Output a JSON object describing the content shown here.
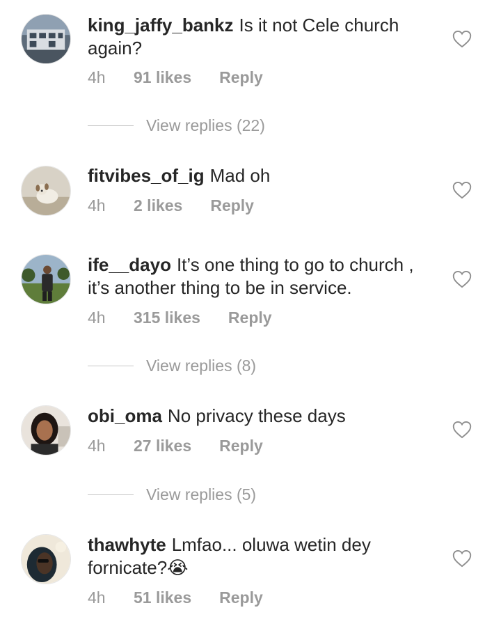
{
  "comments": [
    {
      "username": "king_jaffy_bankz",
      "text": "Is it not Cele church again?",
      "time": "4h",
      "likes": "91 likes",
      "reply": "Reply",
      "view_replies": "View replies (22)"
    },
    {
      "username": "fitvibes_of_ig",
      "text": "Mad oh",
      "time": "4h",
      "likes": "2 likes",
      "reply": "Reply"
    },
    {
      "username": "ife__dayo",
      "text": "It’s one thing to go to church , it’s another thing to be in service.",
      "time": "4h",
      "likes": "315 likes",
      "reply": "Reply",
      "view_replies": "View replies (8)"
    },
    {
      "username": "obi_oma",
      "text": "No privacy these days",
      "time": "4h",
      "likes": "27 likes",
      "reply": "Reply",
      "view_replies": "View replies (5)"
    },
    {
      "username": "thawhyte",
      "text": "Lmfao... oluwa wetin dey fornicate?😭",
      "time": "4h",
      "likes": "51 likes",
      "reply": "Reply"
    }
  ],
  "icons": {
    "like": "heart-outline-icon"
  }
}
